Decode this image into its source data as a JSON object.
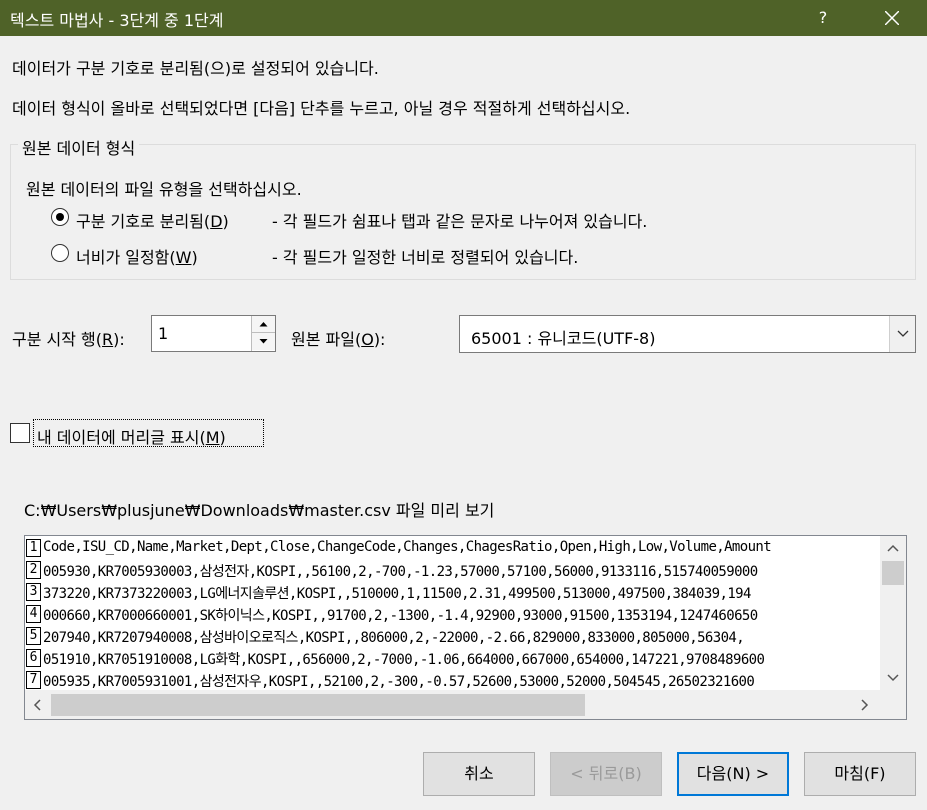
{
  "window": {
    "title": "텍스트 마법사 - 3단계 중 1단계",
    "help_label": "?"
  },
  "intro": {
    "line1": "데이터가 구분 기호로 분리됨(으)로 설정되어 있습니다.",
    "line2": "데이터 형식이 올바로 선택되었다면 [다음] 단추를 누르고, 아닐 경우 적절하게 선택하십시오."
  },
  "source_format": {
    "group_label": "원본 데이터 형식",
    "prompt": "원본 데이터의 파일 유형을 선택하십시오.",
    "options": [
      {
        "label_pre": "구분 기호로 분리됨(",
        "accel": "D",
        "label_post": ")",
        "description": "- 각 필드가 쉼표나 탭과 같은 문자로 나누어져 있습니다.",
        "selected": true
      },
      {
        "label_pre": "너비가 일정함(",
        "accel": "W",
        "label_post": ")",
        "description": "- 각 필드가 일정한 너비로 정렬되어 있습니다.",
        "selected": false
      }
    ]
  },
  "start_row": {
    "label_pre": "구분 시작 행(",
    "accel": "R",
    "label_post": "):",
    "value": "1"
  },
  "file_origin": {
    "label_pre": "원본 파일(",
    "accel": "O",
    "label_post": "):",
    "value": "65001 : 유니코드(UTF-8)"
  },
  "headers_checkbox": {
    "label_pre": "내 데이터에 머리글 표시(",
    "accel": "M",
    "label_post": ")",
    "checked": false
  },
  "preview": {
    "label": "C:₩Users₩plusjune₩Downloads₩master.csv 파일 미리 보기",
    "lines": [
      {
        "num": "1",
        "text": "Code,ISU_CD,Name,Market,Dept,Close,ChangeCode,Changes,ChagesRatio,Open,High,Low,Volume,Amount"
      },
      {
        "num": "2",
        "text": "005930,KR7005930003,삼성전자,KOSPI,,56100,2,-700,-1.23,57000,57100,56000,9133116,515740059000"
      },
      {
        "num": "3",
        "text": "373220,KR7373220003,LG에너지솔루션,KOSPI,,510000,1,11500,2.31,499500,513000,497500,384039,194"
      },
      {
        "num": "4",
        "text": "000660,KR7000660001,SK하이닉스,KOSPI,,91700,2,-1300,-1.4,92900,93000,91500,1353194,1247460650"
      },
      {
        "num": "5",
        "text": "207940,KR7207940008,삼성바이오로직스,KOSPI,,806000,2,-22000,-2.66,829000,833000,805000,56304,"
      },
      {
        "num": "6",
        "text": "051910,KR7051910008,LG화학,KOSPI,,656000,2,-7000,-1.06,664000,667000,654000,147221,9708489600"
      },
      {
        "num": "7",
        "text": "005935,KR7005931001,삼성전자우,KOSPI,,52100,2,-300,-0.57,52600,53000,52000,504545,26502321600"
      }
    ]
  },
  "buttons": {
    "cancel": "취소",
    "back": "< 뒤로(B)",
    "next": "다음(N) >",
    "finish": "마침(F)"
  },
  "colors": {
    "titlebar": "#4f6228",
    "default_button_border": "#0078d7"
  }
}
